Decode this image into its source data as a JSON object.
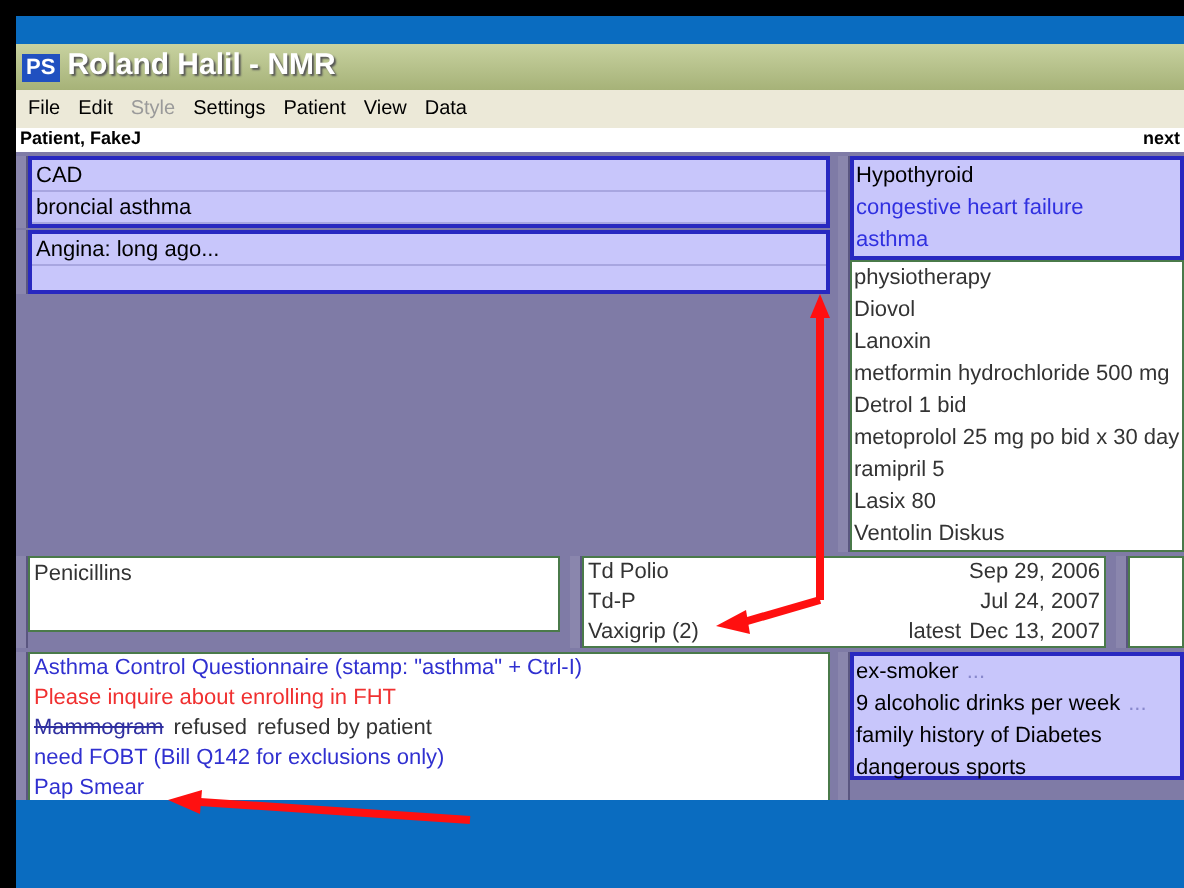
{
  "window": {
    "badge": "PS",
    "title": "Roland Halil - NMR"
  },
  "menu": [
    {
      "label": "File",
      "disabled": false
    },
    {
      "label": "Edit",
      "disabled": false
    },
    {
      "label": "Style",
      "disabled": true
    },
    {
      "label": "Settings",
      "disabled": false
    },
    {
      "label": "Patient",
      "disabled": false
    },
    {
      "label": "View",
      "disabled": false
    },
    {
      "label": "Data",
      "disabled": false
    }
  ],
  "patient_bar": {
    "name": "Patient, FakeJ",
    "next": "next"
  },
  "problems": [
    {
      "lines": [
        "CAD",
        "broncial asthma"
      ]
    },
    {
      "lines": [
        "Angina: long ago..."
      ]
    }
  ],
  "diagnoses": [
    {
      "text": "Hypothyroid",
      "kind": "plain"
    },
    {
      "text": "congestive heart failure",
      "kind": "link"
    },
    {
      "text": "asthma",
      "kind": "link"
    }
  ],
  "medications": [
    "physiotherapy",
    "Diovol",
    "Lanoxin",
    "metformin hydrochloride 500 mg",
    "Detrol 1 bid",
    "metoprolol 25 mg po bid x 30 day",
    "ramipril 5",
    "Lasix 80",
    "Ventolin Diskus"
  ],
  "allergies": [
    "Penicillins"
  ],
  "immunizations": [
    {
      "name": "Td Polio",
      "date": "Sep 29, 2006"
    },
    {
      "name": "Td-P",
      "date": "Jul 24, 2007"
    },
    {
      "name": "Vaxigrip (2)",
      "prefix": "latest",
      "date": "Dec 13, 2007"
    }
  ],
  "reminders": [
    {
      "kind": "link",
      "text": "Asthma Control Questionnaire (stamp: \"asthma\" + Ctrl-I)"
    },
    {
      "kind": "alert",
      "text": "Please inquire about enrolling in FHT"
    },
    {
      "kind": "refused",
      "text": "Mammogram",
      "status": "refused",
      "note": "refused by patient"
    },
    {
      "kind": "link",
      "text": "need FOBT (Bill Q142 for exclusions only)"
    },
    {
      "kind": "link",
      "text": "Pap Smear"
    }
  ],
  "social": [
    {
      "text": "ex-smoker",
      "more": "..."
    },
    {
      "text": "9 alcoholic drinks per week",
      "more": "..."
    },
    {
      "text": "family history of Diabetes"
    },
    {
      "text": "dangerous sports"
    }
  ]
}
